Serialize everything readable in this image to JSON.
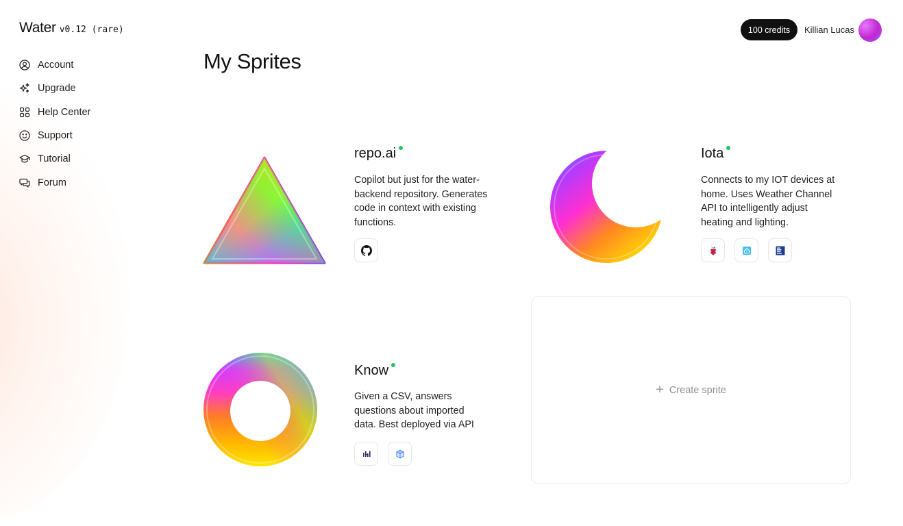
{
  "app": {
    "name": "Water",
    "version": "v0.12 (rare)"
  },
  "sidebar": {
    "items": [
      {
        "label": "Account",
        "icon": "account-circle-icon"
      },
      {
        "label": "Upgrade",
        "icon": "sparkles-icon"
      },
      {
        "label": "Help Center",
        "icon": "grid-icon"
      },
      {
        "label": "Support",
        "icon": "smiley-icon"
      },
      {
        "label": "Tutorial",
        "icon": "graduation-cap-icon"
      },
      {
        "label": "Forum",
        "icon": "chat-bubbles-icon"
      }
    ]
  },
  "header": {
    "credits": "100 credits",
    "user_name": "Killian Lucas"
  },
  "main": {
    "title": "My Sprites",
    "sprites": [
      {
        "name": "repo.ai",
        "shape": "triangle",
        "status": "online",
        "description": "Copilot but just for the water-backend repository. Generates code in context with existing functions.",
        "integrations": [
          "github-icon"
        ]
      },
      {
        "name": "Iota",
        "shape": "crescent-moon",
        "status": "online",
        "description": "Connects to my IOT devices at home. Uses Weather Channel API to intelligently adjust heating and lighting.",
        "integrations": [
          "raspberry-pi-icon",
          "home-assistant-icon",
          "weather-channel-icon"
        ]
      },
      {
        "name": "Know",
        "shape": "ring",
        "status": "online",
        "description": "Given a CSV, answers questions about imported data. Best deployed via API",
        "integrations": [
          "dashboard-icon",
          "cube-icon"
        ]
      }
    ],
    "create_label": "Create sprite"
  },
  "colors": {
    "status_online": "#22c55e",
    "credits_bg": "#111111",
    "avatar": "#c026d3"
  }
}
